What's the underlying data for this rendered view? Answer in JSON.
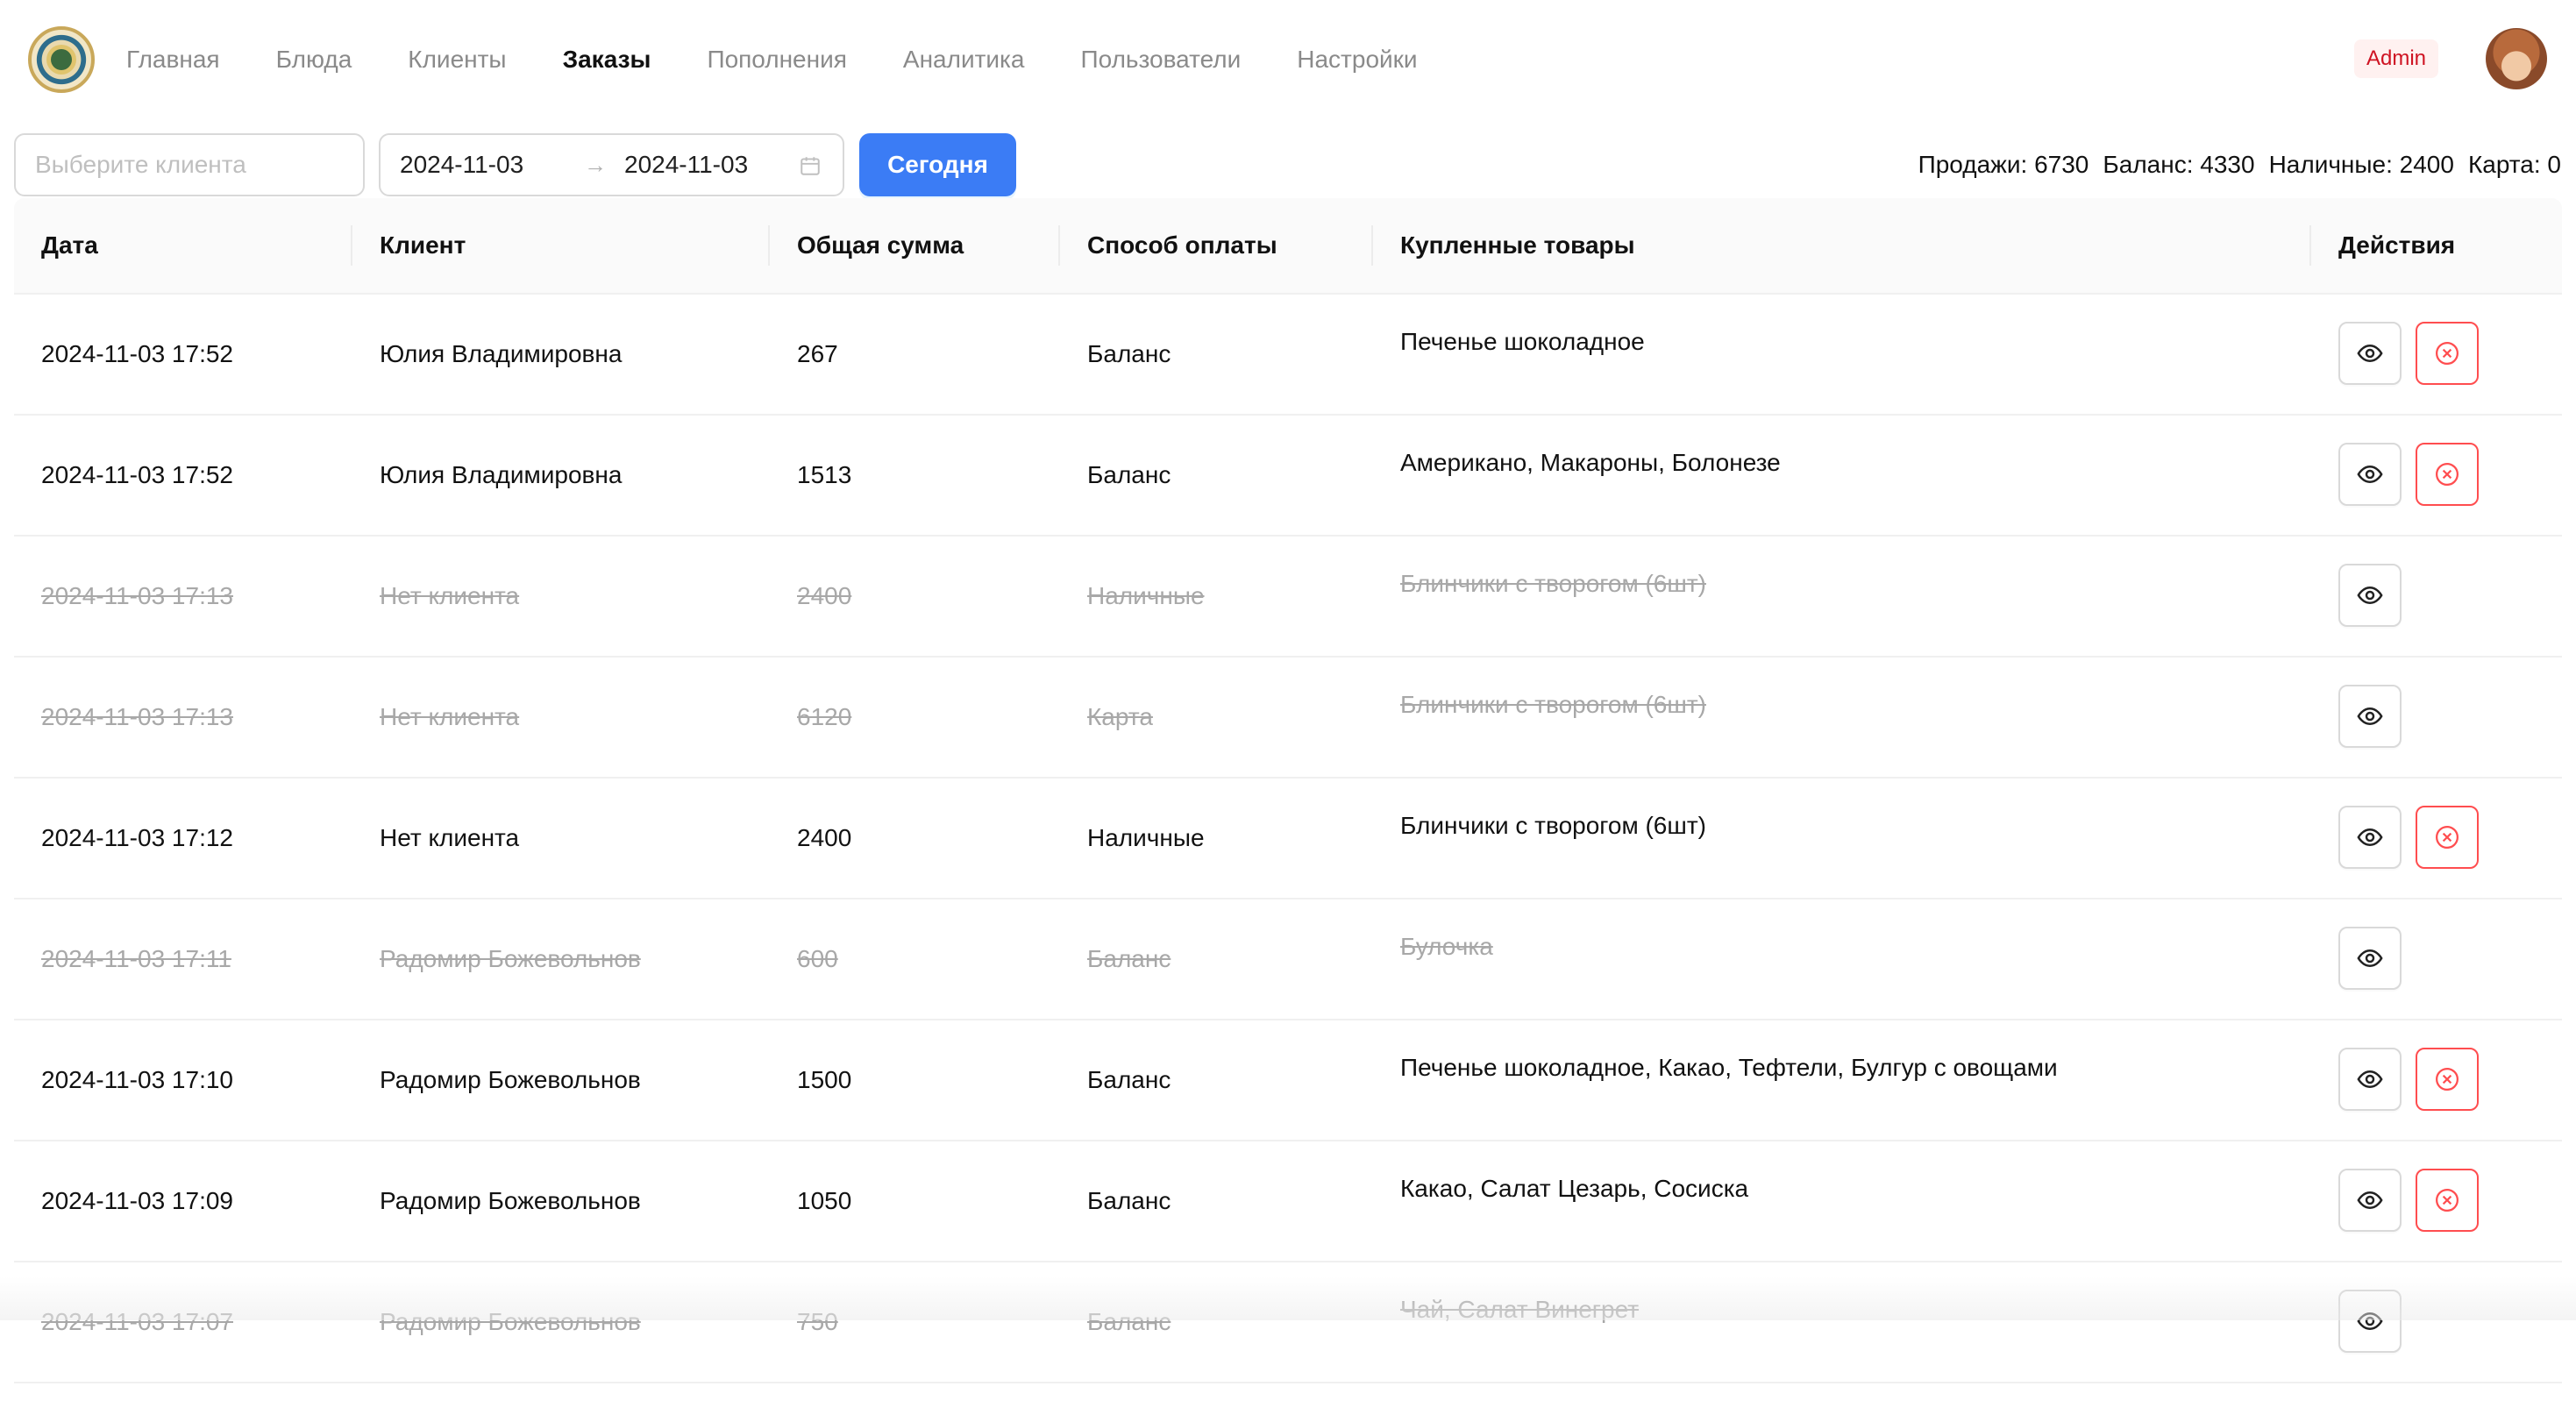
{
  "nav": {
    "items": [
      {
        "label": "Главная",
        "active": false
      },
      {
        "label": "Блюда",
        "active": false
      },
      {
        "label": "Клиенты",
        "active": false
      },
      {
        "label": "Заказы",
        "active": true
      },
      {
        "label": "Пополнения",
        "active": false
      },
      {
        "label": "Аналитика",
        "active": false
      },
      {
        "label": "Пользователи",
        "active": false
      },
      {
        "label": "Настройки",
        "active": false
      }
    ],
    "role_badge": "Admin"
  },
  "filters": {
    "client_placeholder": "Выберите клиента",
    "date_from": "2024-11-03",
    "date_to": "2024-11-03",
    "range_arrow": "→",
    "today_button": "Сегодня"
  },
  "stats": {
    "sales": "Продажи: 6730",
    "balance": "Баланс: 4330",
    "cash": "Наличные: 2400",
    "card": "Карта: 0"
  },
  "table": {
    "columns": [
      "Дата",
      "Клиент",
      "Общая сумма",
      "Способ оплаты",
      "Купленные товары",
      "Действия"
    ],
    "rows": [
      {
        "date": "2024-11-03 17:52",
        "client": "Юлия Владимировна",
        "total": "267",
        "payment": "Баланс",
        "items": "Печенье шоколадное",
        "cancelled": false
      },
      {
        "date": "2024-11-03 17:52",
        "client": "Юлия Владимировна",
        "total": "1513",
        "payment": "Баланс",
        "items": "Американо, Макароны, Болонезе",
        "cancelled": false
      },
      {
        "date": "2024-11-03 17:13",
        "client": "Нет клиента",
        "total": "2400",
        "payment": "Наличные",
        "items": "Блинчики с творогом (6шт)",
        "cancelled": true
      },
      {
        "date": "2024-11-03 17:13",
        "client": "Нет клиента",
        "total": "6120",
        "payment": "Карта",
        "items": "Блинчики с творогом (6шт)",
        "cancelled": true
      },
      {
        "date": "2024-11-03 17:12",
        "client": "Нет клиента",
        "total": "2400",
        "payment": "Наличные",
        "items": "Блинчики с творогом (6шт)",
        "cancelled": false
      },
      {
        "date": "2024-11-03 17:11",
        "client": "Радомир Божевольнов",
        "total": "600",
        "payment": "Баланс",
        "items": "Булочка",
        "cancelled": true
      },
      {
        "date": "2024-11-03 17:10",
        "client": "Радомир Божевольнов",
        "total": "1500",
        "payment": "Баланс",
        "items": "Печенье шоколадное, Какао, Тефтели, Булгур с овощами",
        "cancelled": false
      },
      {
        "date": "2024-11-03 17:09",
        "client": "Радомир Божевольнов",
        "total": "1050",
        "payment": "Баланс",
        "items": "Какао, Салат Цезарь, Сосиска",
        "cancelled": false
      },
      {
        "date": "2024-11-03 17:07",
        "client": "Радомир Божевольнов",
        "total": "750",
        "payment": "Баланс",
        "items": "Чай, Салат Винегрет",
        "cancelled": true
      }
    ]
  },
  "icons": {
    "view": "eye-icon",
    "cancel": "close-circle-icon",
    "calendar": "calendar-icon"
  },
  "colors": {
    "primary": "#3b7cf5",
    "danger": "#ff4d4f",
    "muted_text": "#a8a8a8"
  }
}
